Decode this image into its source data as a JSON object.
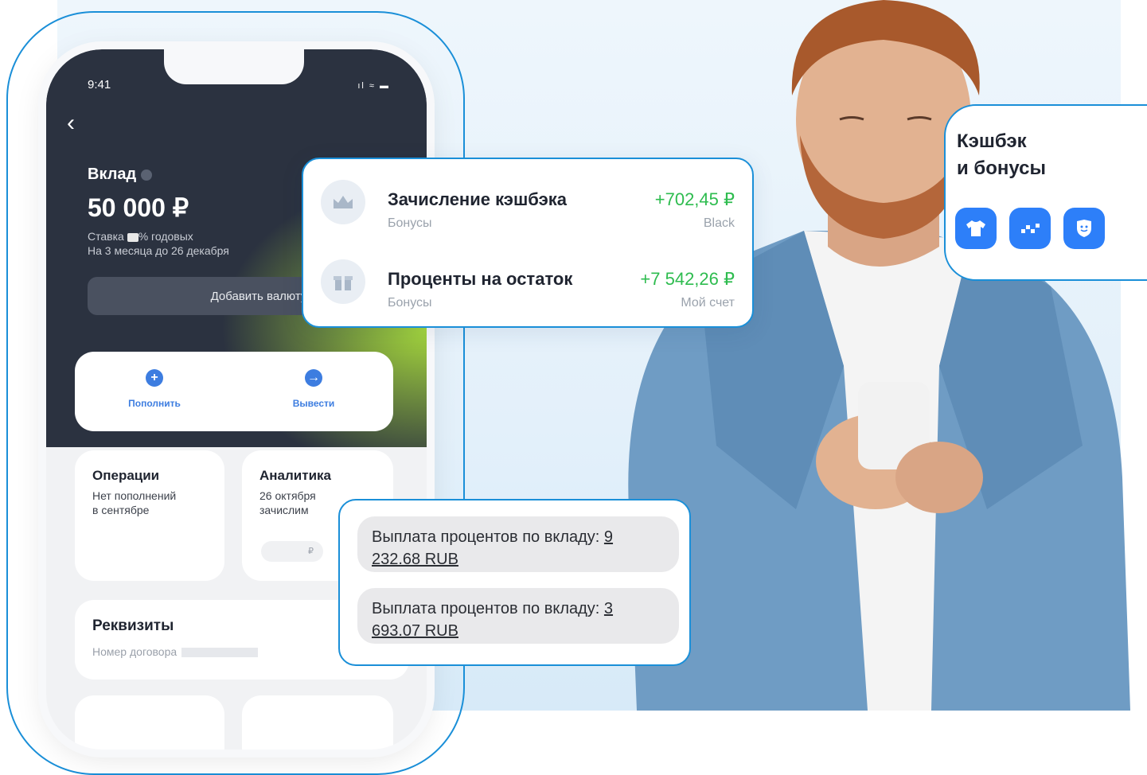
{
  "phone": {
    "status_time": "9:41",
    "status_icons": "ıl ≈ ▬",
    "back_icon": "chevron-left",
    "deposit_title": "Вклад",
    "deposit_amount": "50 000 ₽",
    "rate_prefix": "Ставка",
    "rate_suffix": "% годовых",
    "term": "На 3 месяца до 26 декабря",
    "add_currency": "Добавить валюту",
    "action_topup": "Пополнить",
    "action_withdraw": "Вывести",
    "ops_title": "Операции",
    "ops_text1": "Нет пополнений",
    "ops_text2": "в сентябре",
    "analytics_title": "Аналитика",
    "analytics_text1": "26 октября",
    "analytics_text2": "зачислим",
    "analytics_pill_currency": "₽",
    "requisites_title": "Реквизиты",
    "contract_label": "Номер договора"
  },
  "transactions": [
    {
      "name": "Зачисление кэшбэка",
      "category": "Бонусы",
      "amount": "+702,45 ₽",
      "meta": "Black",
      "icon": "crown-icon"
    },
    {
      "name": "Проценты на остаток",
      "category": "Бонусы",
      "amount": "+7 542,26 ₽",
      "meta": "Мой счет",
      "icon": "gift-icon"
    }
  ],
  "bonus": {
    "title_line1": "Кэшбэк",
    "title_line2": "и бонусы",
    "icons": [
      "tshirt-icon",
      "checker-icon",
      "shield-icon"
    ]
  },
  "sms": [
    {
      "prefix": "Выплата процентов по вкладу: ",
      "num_a": "9",
      "num_b": "232.68 RUB"
    },
    {
      "prefix": "Выплата процентов по вкладу: ",
      "num_a": "3",
      "num_b": "693.07 RUB"
    }
  ],
  "colors": {
    "accent": "#1a8fd8",
    "positive": "#2ebc4f",
    "button_blue": "#2d7ff9",
    "dark_header": "#2b3240"
  }
}
